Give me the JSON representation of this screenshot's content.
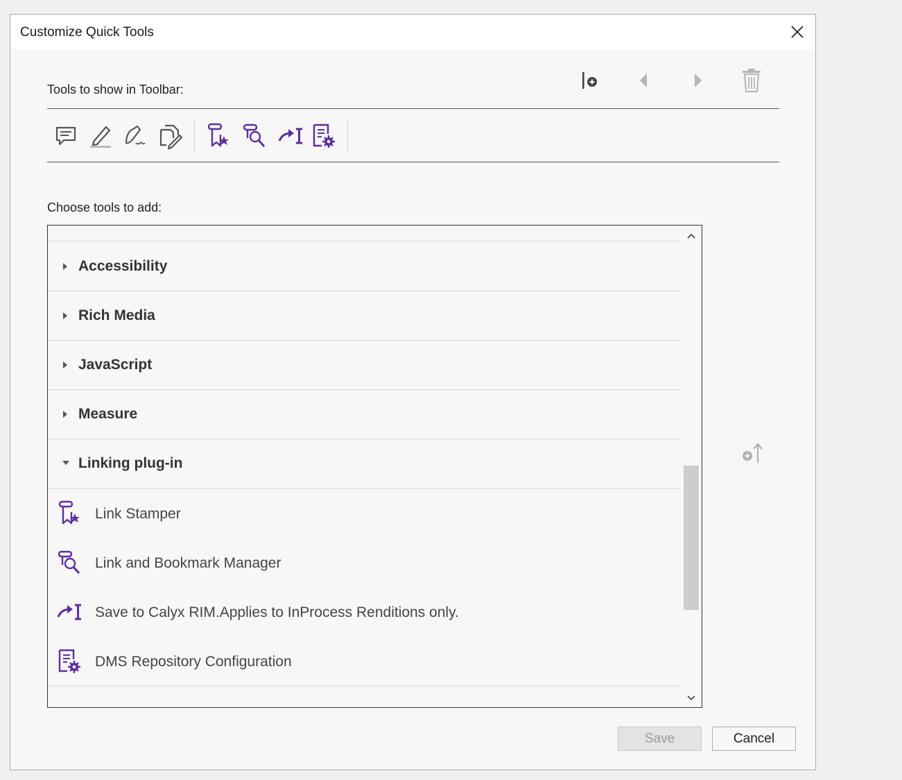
{
  "dialog": {
    "title": "Customize Quick Tools",
    "close_icon": "close-icon"
  },
  "toolbar_section": {
    "label": "Tools to show in Toolbar:",
    "actions": [
      {
        "name": "add-separator-icon",
        "enabled": true
      },
      {
        "name": "move-left-icon",
        "enabled": false
      },
      {
        "name": "move-right-icon",
        "enabled": false
      },
      {
        "name": "delete-icon",
        "enabled": false
      }
    ],
    "tools": [
      {
        "icon": "comment-icon"
      },
      {
        "icon": "highlight-pen-icon"
      },
      {
        "icon": "sign-icon"
      },
      {
        "icon": "edit-document-icon"
      },
      {
        "icon": "link-stamper-icon"
      },
      {
        "icon": "link-bookmark-manager-icon"
      },
      {
        "icon": "save-to-calyx-icon"
      },
      {
        "icon": "dms-repository-icon"
      }
    ]
  },
  "choose_section": {
    "label": "Choose tools to add:",
    "categories": [
      {
        "label": "Accessibility",
        "expanded": false
      },
      {
        "label": "Rich Media",
        "expanded": false
      },
      {
        "label": "JavaScript",
        "expanded": false
      },
      {
        "label": "Measure",
        "expanded": false
      },
      {
        "label": "Linking plug-in",
        "expanded": true
      }
    ],
    "tools": [
      {
        "label": "Link Stamper",
        "icon": "link-stamper-icon"
      },
      {
        "label": "Link and Bookmark Manager",
        "icon": "link-bookmark-manager-icon"
      },
      {
        "label": "Save to Calyx RIM.Applies to InProcess Renditions only.",
        "icon": "save-to-calyx-icon"
      },
      {
        "label": "DMS Repository Configuration",
        "icon": "dms-repository-icon"
      }
    ],
    "add_icon": "add-to-toolbar-icon"
  },
  "buttons": {
    "save": "Save",
    "cancel": "Cancel"
  },
  "colors": {
    "accent_purple": "#5b2d9e",
    "icon_gray": "#555555",
    "disabled_gray": "#b0b0b0"
  }
}
